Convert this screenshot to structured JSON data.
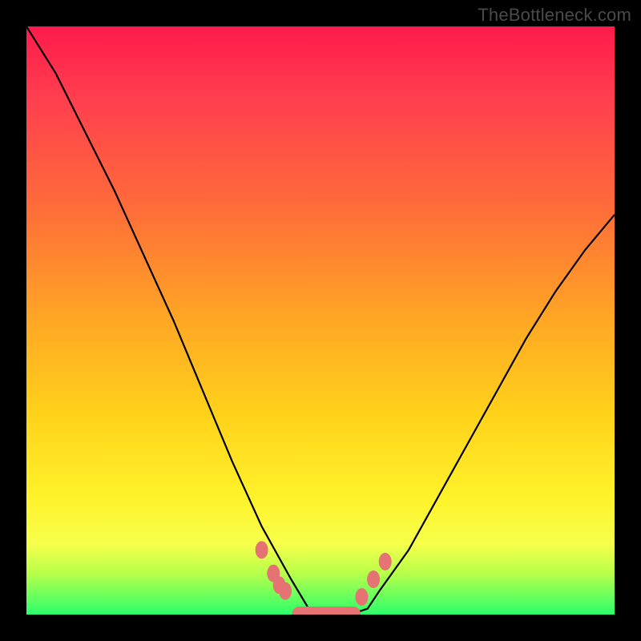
{
  "watermark": "TheBottleneck.com",
  "chart_data": {
    "type": "line",
    "title": "",
    "xlabel": "",
    "ylabel": "",
    "xlim": [
      0,
      100
    ],
    "ylim": [
      0,
      100
    ],
    "series": [
      {
        "name": "bottleneck-curve",
        "x": [
          0,
          5,
          10,
          15,
          20,
          25,
          30,
          35,
          40,
          45,
          48,
          50,
          52,
          55,
          58,
          60,
          65,
          70,
          75,
          80,
          85,
          90,
          95,
          100
        ],
        "values": [
          100,
          92,
          82,
          72,
          61,
          50,
          38,
          26,
          15,
          6,
          1,
          0,
          0,
          0,
          1,
          4,
          11,
          20,
          29,
          38,
          47,
          55,
          62,
          68
        ]
      },
      {
        "name": "bottom-dots-left",
        "x": [
          40,
          42,
          43,
          44
        ],
        "values": [
          11,
          7,
          5,
          4
        ]
      },
      {
        "name": "bottom-dots-right",
        "x": [
          57,
          59,
          61
        ],
        "values": [
          3,
          6,
          9
        ]
      },
      {
        "name": "bottom-bar",
        "x": [
          46,
          48,
          50,
          52,
          54,
          56
        ],
        "values": [
          0,
          0,
          0,
          0,
          0,
          0
        ]
      }
    ],
    "colors": {
      "gradient_top": "#ff1a4b",
      "gradient_mid": "#ffd21a",
      "gradient_bottom": "#2bff6b",
      "curve": "#000000",
      "dots": "#e57373"
    }
  }
}
